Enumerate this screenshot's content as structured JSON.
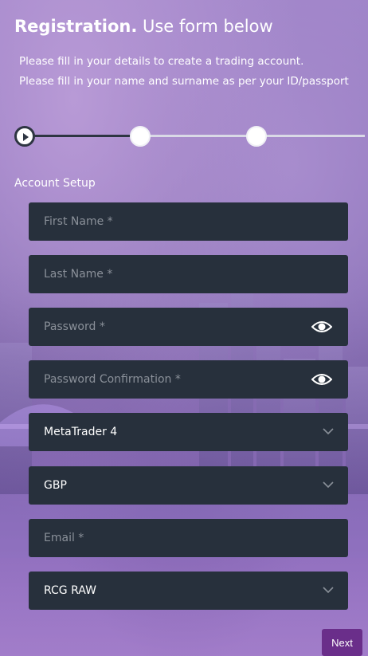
{
  "header": {
    "title_strong": "Registration.",
    "title_light": "Use form below",
    "subtitle_1": "Please fill in your details to create a trading account.",
    "subtitle_2": "Please fill in your name and surname as per your ID/passport"
  },
  "stepper": {
    "total_steps": 3,
    "current_step": 1
  },
  "section": {
    "label": "Account Setup"
  },
  "form": {
    "first_name": {
      "placeholder": "First Name  *"
    },
    "last_name": {
      "placeholder": "Last Name  *"
    },
    "password": {
      "placeholder": "Password  *",
      "icon": "eye-icon"
    },
    "password_confirmation": {
      "placeholder": "Password Confirmation  *",
      "icon": "eye-icon"
    },
    "platform": {
      "value": "MetaTrader 4",
      "icon": "chevron-down-icon"
    },
    "currency": {
      "value": "GBP",
      "icon": "chevron-down-icon"
    },
    "email": {
      "placeholder": "Email  *"
    },
    "account_type": {
      "value": "RCG RAW",
      "icon": "chevron-down-icon"
    }
  },
  "actions": {
    "next_label": "Next"
  },
  "colors": {
    "field_bg": "#27303c",
    "accent": "#6a2e8a",
    "stepper_done": "#2e3542"
  }
}
